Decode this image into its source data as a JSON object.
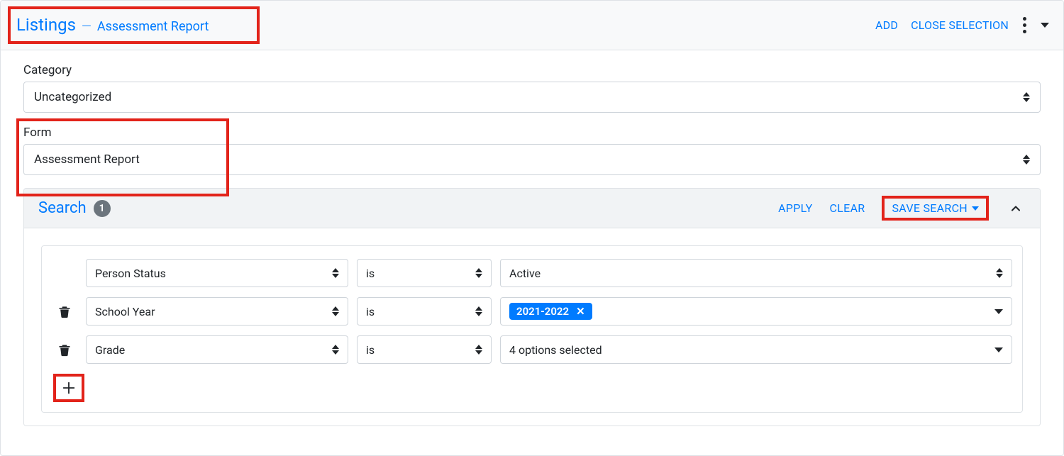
{
  "header": {
    "title_main": "Listings",
    "title_sep": "—",
    "title_sub": "Assessment Report",
    "add_label": "ADD",
    "close_label": "CLOSE SELECTION"
  },
  "fields": {
    "category_label": "Category",
    "category_value": "Uncategorized",
    "form_label": "Form",
    "form_value": "Assessment Report"
  },
  "search": {
    "title": "Search",
    "badge": "1",
    "apply_label": "APPLY",
    "clear_label": "CLEAR",
    "save_label": "SAVE SEARCH"
  },
  "filters": [
    {
      "deletable": false,
      "field": "Person Status",
      "operator": "is",
      "value_type": "select",
      "value_text": "Active"
    },
    {
      "deletable": true,
      "field": "School Year",
      "operator": "is",
      "value_type": "tags",
      "tags": [
        "2021-2022"
      ]
    },
    {
      "deletable": true,
      "field": "Grade",
      "operator": "is",
      "value_type": "multiselect",
      "value_text": "4 options selected"
    }
  ]
}
